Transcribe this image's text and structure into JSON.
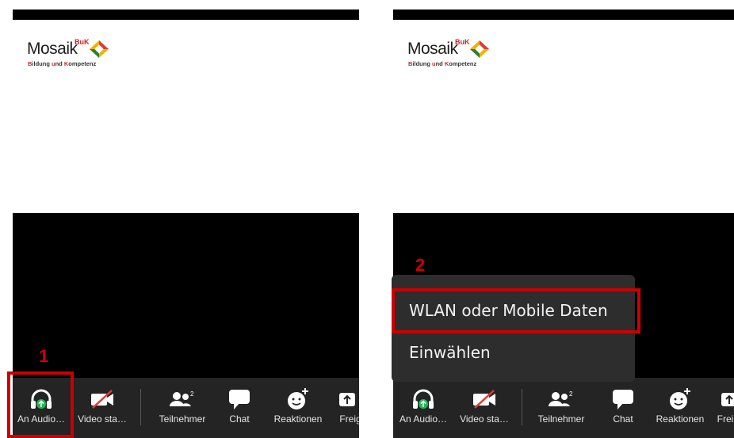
{
  "logo": {
    "word": "Mosaik",
    "superscript": "BuK",
    "subtitle_parts": [
      "B",
      "ildung ",
      "u",
      "nd ",
      "K",
      "ompetenz"
    ]
  },
  "left_panel": {
    "step_number": "1",
    "toolbar": [
      {
        "label": "An Audio…",
        "icon": "headphones-icon"
      },
      {
        "label": "Video sta…",
        "icon": "video-off-icon"
      },
      {
        "label": "Teilnehmer",
        "icon": "participants-icon",
        "badge": "2"
      },
      {
        "label": "Chat",
        "icon": "chat-icon"
      },
      {
        "label": "Reaktionen",
        "icon": "reaction-icon"
      },
      {
        "label": "Freig",
        "icon": "share-icon"
      }
    ]
  },
  "right_panel": {
    "step_number": "2",
    "menu": {
      "items": [
        {
          "label": "WLAN oder Mobile Daten"
        },
        {
          "label": "Einwählen"
        }
      ]
    },
    "toolbar": [
      {
        "label": "An Audio…",
        "icon": "headphones-icon"
      },
      {
        "label": "Video sta…",
        "icon": "video-off-icon"
      },
      {
        "label": "Teilnehmer",
        "icon": "participants-icon",
        "badge": "2"
      },
      {
        "label": "Chat",
        "icon": "chat-icon"
      },
      {
        "label": "Reaktionen",
        "icon": "reaction-icon"
      },
      {
        "label": "Frei",
        "icon": "share-icon"
      }
    ]
  },
  "colors": {
    "highlight": "#cc0000",
    "toolbar_bg": "#242424",
    "audio_green": "#1db954",
    "video_off_red": "#e53935"
  }
}
